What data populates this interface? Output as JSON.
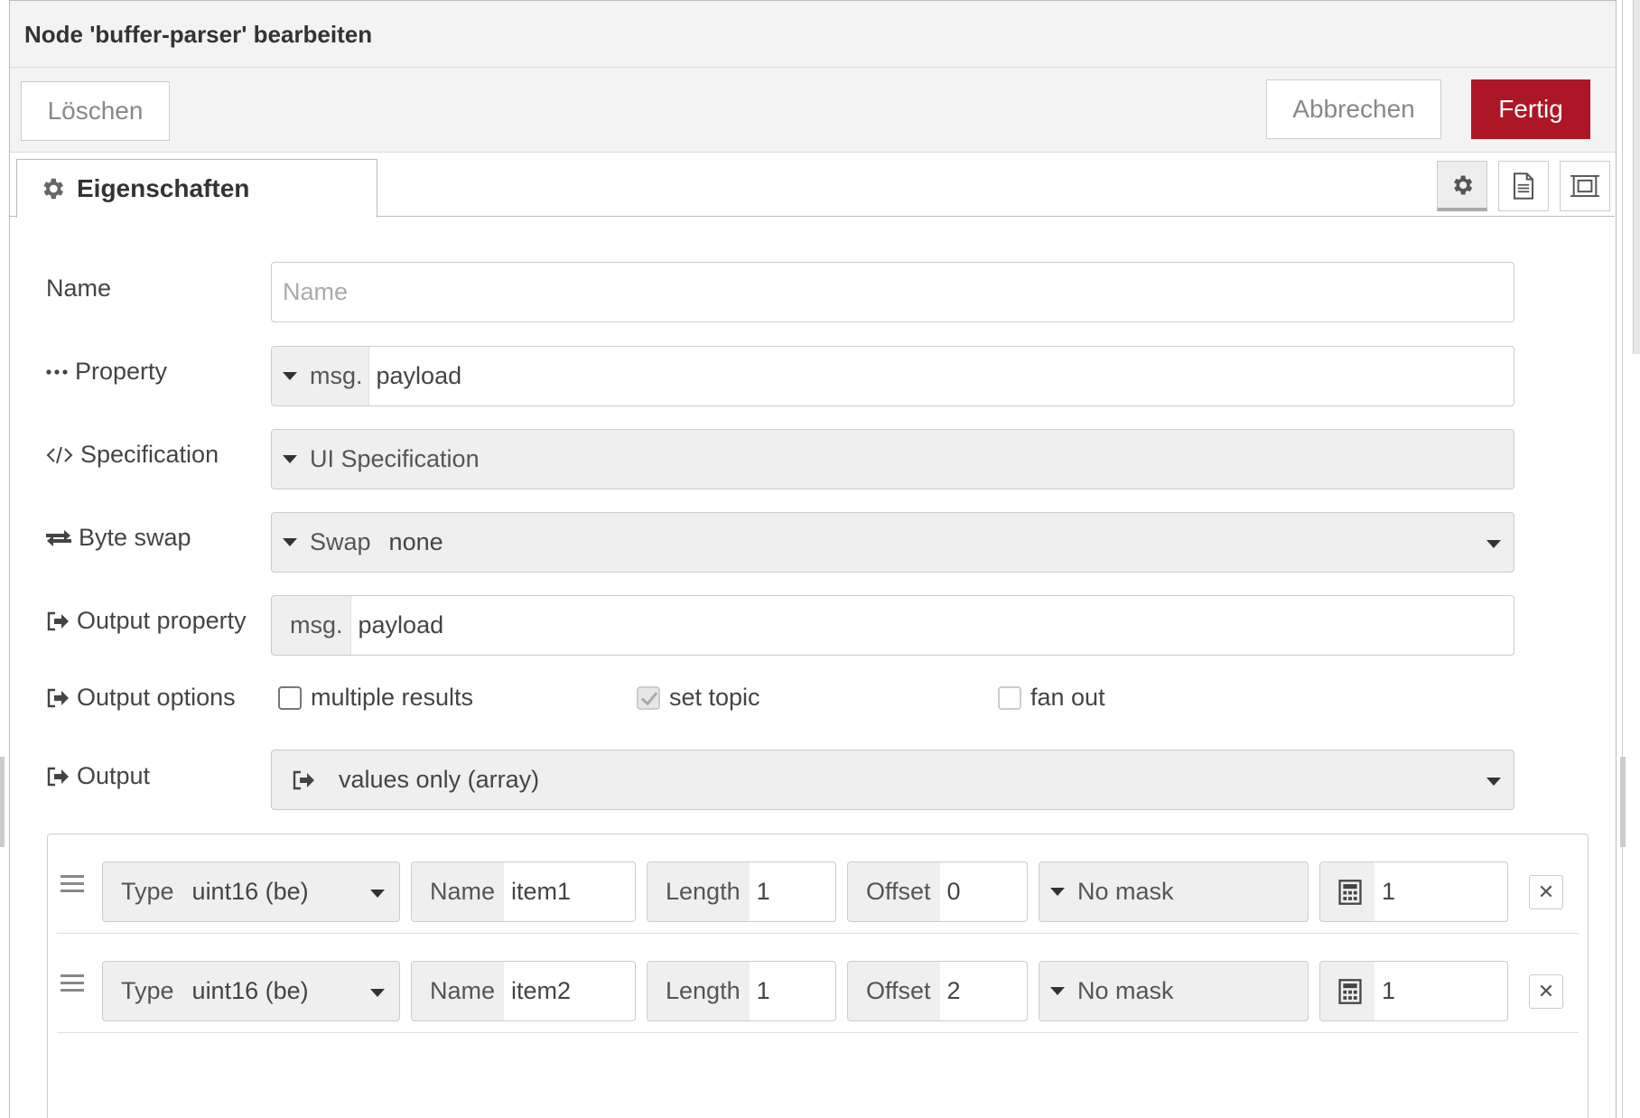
{
  "dialog": {
    "title": "Node 'buffer-parser' bearbeiten",
    "buttons": {
      "delete": "Löschen",
      "cancel": "Abbrechen",
      "done": "Fertig"
    },
    "accent_color": "#ad1625"
  },
  "tabs": [
    {
      "label": "Eigenschaften",
      "icon": "gear-icon"
    }
  ],
  "tab_tools": [
    "gear-icon",
    "description-icon",
    "appearance-icon"
  ],
  "form": {
    "name": {
      "label": "Name",
      "placeholder": "Name",
      "value": ""
    },
    "property": {
      "label": "Property",
      "prefix": "msg.",
      "value": "payload"
    },
    "specification": {
      "label": "Specification",
      "value": "UI Specification"
    },
    "byte_swap": {
      "label": "Byte swap",
      "type": "Swap",
      "value": "none"
    },
    "output_property": {
      "label": "Output property",
      "prefix": "msg.",
      "value": "payload"
    },
    "output_options": {
      "label": "Output options",
      "options": [
        {
          "label": "multiple results",
          "checked": false
        },
        {
          "label": "set topic",
          "checked": true
        },
        {
          "label": "fan out",
          "checked": false
        }
      ]
    },
    "output": {
      "label": "Output",
      "value": "values only (array)"
    }
  },
  "items": [
    {
      "type_label": "Type",
      "type": "uint16 (be)",
      "name_label": "Name",
      "name": "item1",
      "length_label": "Length",
      "length": "1",
      "offset_label": "Offset",
      "offset": "0",
      "mask": "No mask",
      "scale": "1"
    },
    {
      "type_label": "Type",
      "type": "uint16 (be)",
      "name_label": "Name",
      "name": "item2",
      "length_label": "Length",
      "length": "1",
      "offset_label": "Offset",
      "offset": "2",
      "mask": "No mask",
      "scale": "1"
    }
  ]
}
